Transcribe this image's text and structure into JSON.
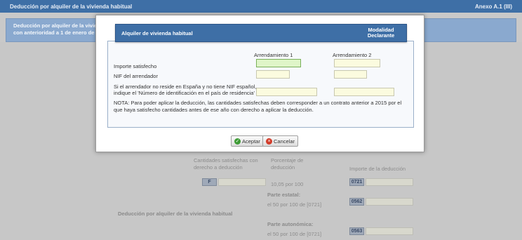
{
  "page": {
    "header_title": "Deducción por alquiler de la vivienda habitual",
    "header_right": "Anexo A.1 (III)",
    "info_line1": "Deducción por alquiler de la vivie",
    "info_line2": "con anterioridad a 1 de enero de 2"
  },
  "background": {
    "col1_line1": "Cantidades satisfechas con",
    "col1_line2": "derecho a deducción",
    "col2_line1": "Porcentaje de",
    "col2_line2": "deducción",
    "col3": "Importe de la deducción",
    "f_code": "F",
    "pct": "10,05 por 100",
    "code_0721": "0721",
    "estatal_title": "Parte estatal:",
    "estatal_desc": "el 50 por 100 de [0721]",
    "code_0562": "0562",
    "section_label": "Deducción por alquiler de la vivienda habitual",
    "autonomica_title": "Parte autonómica:",
    "autonomica_desc": "el 50 por 100 de [0721]",
    "code_0563": "0563"
  },
  "modal": {
    "title": "Alquiler de vivienda habitual",
    "modalidad_line1": "Modalidad",
    "modalidad_line2": "Declarante",
    "col_a1": "Arrendamiento 1",
    "col_a2": "Arrendamiento 2",
    "row_importe": "Importe satisfecho",
    "row_nif": "NIF del arrendador",
    "row_extranjero_line1": "Si el arrendador no reside en España y no tiene NIF español,",
    "row_extranjero_line2": "indique el 'Número de identificación en el país de residencia'",
    "importe_1": "",
    "importe_2": "",
    "nif_1": "",
    "nif_2": "",
    "id_1": "",
    "id_2": "",
    "nota": "NOTA: Para poder aplicar la deducción, las cantidades satisfechas deben corresponder a un contrato anterior a 2015 por el que haya satisfecho cantidades antes de ese año con derecho a aplicar la deducción.",
    "accept_label": "Aceptar",
    "cancel_label": "Cancelar"
  },
  "colors": {
    "accent": "#3e6fa6",
    "active_field": "#dff5c8",
    "field": "#fbfbdf"
  }
}
